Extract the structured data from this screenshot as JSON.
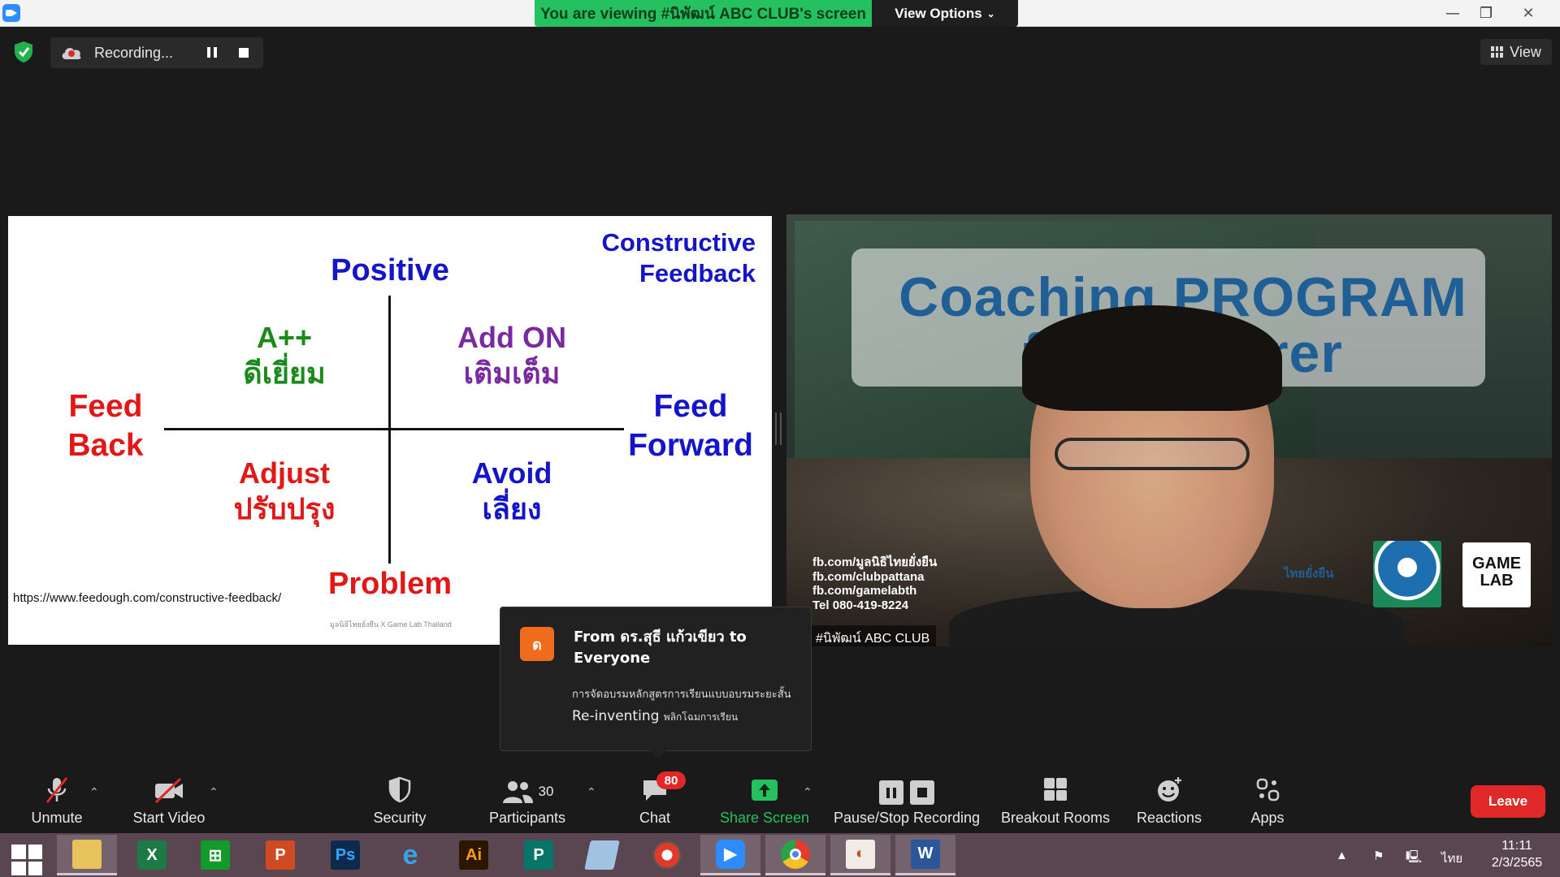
{
  "titlebar": {
    "banner": "You are viewing #นิพัฒน์ ABC CLUB's screen",
    "view_options": "View Options",
    "minimize": "—",
    "restore": "❐",
    "close": "✕"
  },
  "recording": {
    "label": "Recording...",
    "view_label": "View"
  },
  "slide": {
    "top_axis": "Positive",
    "bottom_axis": "Problem",
    "left_axis_line1": "Feed",
    "left_axis_line2": "Back",
    "right_axis_line1": "Feed",
    "right_axis_line2": "Forward",
    "corner_line1": "Constructive",
    "corner_line2": "Feedback",
    "q1_line1": "A++",
    "q1_line2": "ดีเยี่ยม",
    "q2_line1": "Add ON",
    "q2_line2": "เติมเต็ม",
    "q3_line1": "Adjust",
    "q3_line2": "ปรับปรุง",
    "q4_line1": "Avoid",
    "q4_line2": "เลี่ยง",
    "source_url": "https://www.feedough.com/constructive-feedback/",
    "footer": "มูลนิธิไทยยั่งยืน X Game Lab Thailand",
    "colors": {
      "blue": "#1414c8",
      "green": "#1a8a1a",
      "purple": "#7a2aa0",
      "red": "#e01818"
    }
  },
  "video": {
    "title_line1": "Coaching PROGRAM",
    "title_line2": "for Lecturer",
    "contacts": [
      "fb.com/มูลนิธิไทยยั่งยืน",
      "fb.com/clubpattana",
      "fb.com/gamelabth",
      "Tel 080-419-8224"
    ],
    "org_label": "ไทยยั่งยืน",
    "gamelab_logo": "GAME LAB",
    "participant_name": "#นิพัฒน์ ABC CLUB"
  },
  "chat_popup": {
    "avatar_letter": "ด",
    "from": "From ดร.สุธี  แก้วเขียว to Everyone",
    "line1": "การจัดอบรมหลักสูตรการเรียนแบบอบรมระยะสั้น",
    "line2_main": "Re-inventing",
    "line2_small": "พลิกโฉมการเรียน"
  },
  "toolbar": {
    "unmute": "Unmute",
    "start_video": "Start Video",
    "security": "Security",
    "participants": "Participants",
    "participants_count": "30",
    "chat": "Chat",
    "chat_badge": "80",
    "share_screen": "Share Screen",
    "pause_stop_recording": "Pause/Stop Recording",
    "breakout_rooms": "Breakout Rooms",
    "reactions": "Reactions",
    "apps": "Apps",
    "leave": "Leave",
    "share_color": "#25c160"
  },
  "taskbar": {
    "apps": [
      "file-explorer",
      "excel",
      "store",
      "powerpoint",
      "photoshop",
      "internet-explorer",
      "illustrator",
      "publisher",
      "notepad",
      "photoscape",
      "zoom",
      "chrome",
      "ppt-viewer",
      "word"
    ],
    "language": "ไทย",
    "time": "11:11",
    "date": "2/3/2565"
  }
}
